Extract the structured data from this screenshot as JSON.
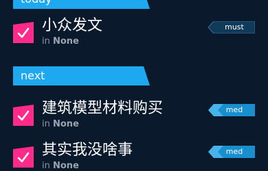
{
  "sections": [
    {
      "label": "today"
    },
    {
      "label": "next"
    }
  ],
  "tasks": [
    {
      "title": "小众发文",
      "in_label": "in",
      "project": "None",
      "priority": "must",
      "priority_color": "#0f3a5a",
      "checked": true
    },
    {
      "title": "建筑模型材料购买",
      "in_label": "in",
      "project": "None",
      "priority": "med",
      "priority_color": "#1a8fd0",
      "checked": true
    },
    {
      "title": "其实我没啥事",
      "in_label": "in",
      "project": "None",
      "priority": "med",
      "priority_color": "#1a8fd0",
      "checked": true
    }
  ],
  "colors": {
    "background": "#0a1a2c",
    "banner": "#1ea8f0",
    "checkbox": "#ff2a8a",
    "title_text": "#ffffff",
    "meta_text": "#8a96a3"
  }
}
